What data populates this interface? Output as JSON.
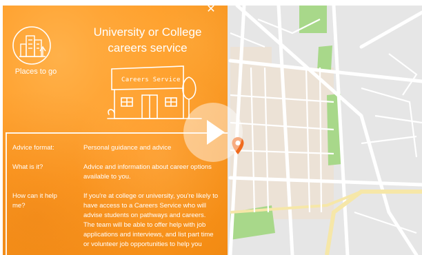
{
  "panel": {
    "title_line1": "University or College",
    "title_line2": "careers service",
    "places_label": "Places to go",
    "building_sign": "Careers Service",
    "close_icon": "close-icon",
    "rows": [
      {
        "label": "Advice format:",
        "value": "Personal guidance and advice"
      },
      {
        "label": "What is it?",
        "value": "Advice and information about career options available to you."
      },
      {
        "label": "How can it help me?",
        "value": "If you're at college or university, you're likely to have access to a Careers Service who will advise students on pathways and careers. The team will be able to offer help with job applications and interviews, and list part time or volunteer job opportunities to help you"
      }
    ]
  },
  "media": {
    "play_icon": "play-icon",
    "pin_icon": "map-pin-icon"
  },
  "colors": {
    "panel_orange": "#ff9b24",
    "map_bg": "#e6e6e6",
    "park_green": "#a8d88a",
    "pin_orange": "#f06a1c"
  }
}
